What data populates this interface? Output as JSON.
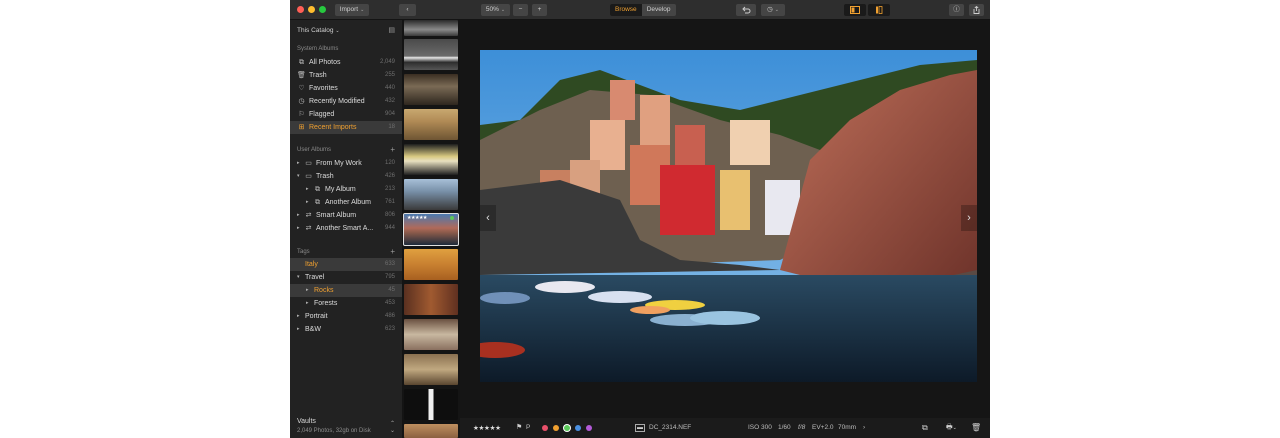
{
  "toolbar": {
    "import_label": "Import",
    "zoom_label": "50%",
    "minus_label": "−",
    "plus_label": "+",
    "mode_browse": "Browse",
    "mode_develop": "Develop"
  },
  "sidebar": {
    "catalog_label": "This Catalog",
    "system_albums_label": "System Albums",
    "system_albums": [
      {
        "label": "All Photos",
        "count": "2,049",
        "icon": "photos-icon"
      },
      {
        "label": "Trash",
        "count": "255",
        "icon": "trash-icon"
      },
      {
        "label": "Favorites",
        "count": "440",
        "icon": "heart-icon"
      },
      {
        "label": "Recently Modified",
        "count": "432",
        "icon": "clock-icon"
      },
      {
        "label": "Flagged",
        "count": "904",
        "icon": "flag-icon"
      },
      {
        "label": "Recent Imports",
        "count": "18",
        "icon": "import-icon"
      }
    ],
    "user_albums_label": "User Albums",
    "user_albums": [
      {
        "label": "From My Work",
        "count": "120"
      },
      {
        "label": "Trash",
        "count": "426"
      },
      {
        "label": "My Album",
        "count": "213"
      },
      {
        "label": "Another Album",
        "count": "761"
      },
      {
        "label": "Smart Album",
        "count": "806"
      },
      {
        "label": "Another Smart A...",
        "count": "944"
      }
    ],
    "tags_label": "Tags",
    "tags": [
      {
        "label": "Italy",
        "count": "633"
      },
      {
        "label": "Travel",
        "count": "795"
      },
      {
        "label": "Rocks",
        "count": "45"
      },
      {
        "label": "Forests",
        "count": "453"
      },
      {
        "label": "Portrait",
        "count": "486"
      },
      {
        "label": "B&W",
        "count": "623"
      }
    ],
    "vaults_label": "Vaults",
    "vaults_info": "2,049 Photos, 32gb on Disk"
  },
  "filmstrip": {
    "selected_rating": "★★★★★"
  },
  "bottom": {
    "rating": "★★★★★",
    "flag_label": "P",
    "color_labels": [
      "#e8506a",
      "#f0a030",
      "#5bc95b",
      "#4a90e2",
      "#b35ad8"
    ],
    "filename": "DC_2314.NEF",
    "iso": "ISO 300",
    "shutter": "1/60",
    "aperture": "f/8",
    "ev": "EV+2.0",
    "focal": "70mm",
    "more": "›"
  },
  "colors": {
    "accent": "#f0a030",
    "sidebar_bg": "#222222",
    "app_bg": "#1b1b1b"
  }
}
